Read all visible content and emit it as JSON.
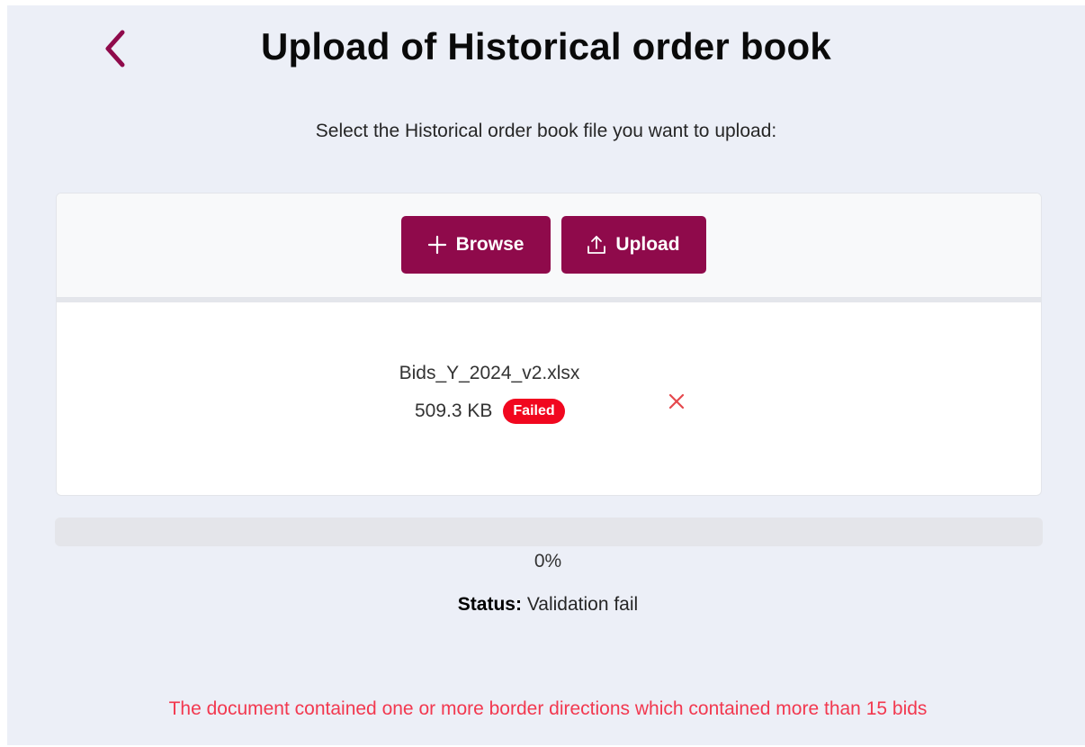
{
  "header": {
    "title": "Upload of Historical order book"
  },
  "instruction": "Select the Historical order book file you want to upload:",
  "toolbar": {
    "browse_label": "Browse",
    "upload_label": "Upload"
  },
  "file": {
    "name": "Bids_Y_2024_v2.xlsx",
    "size": "509.3 KB",
    "status_badge": "Failed"
  },
  "progress": {
    "percent": 0,
    "label": "0%"
  },
  "status": {
    "label": "Status:",
    "value": "Validation fail"
  },
  "error_message": "The document contained one or more border directions which contained more than 15 bids",
  "colors": {
    "accent": "#8f0a4b",
    "background": "#eceff7",
    "error": "#f2384f",
    "badge_failed": "#f1071f"
  },
  "icons": {
    "back": "chevron-left-icon",
    "browse": "plus-icon",
    "upload": "upload-icon",
    "remove": "close-icon"
  }
}
